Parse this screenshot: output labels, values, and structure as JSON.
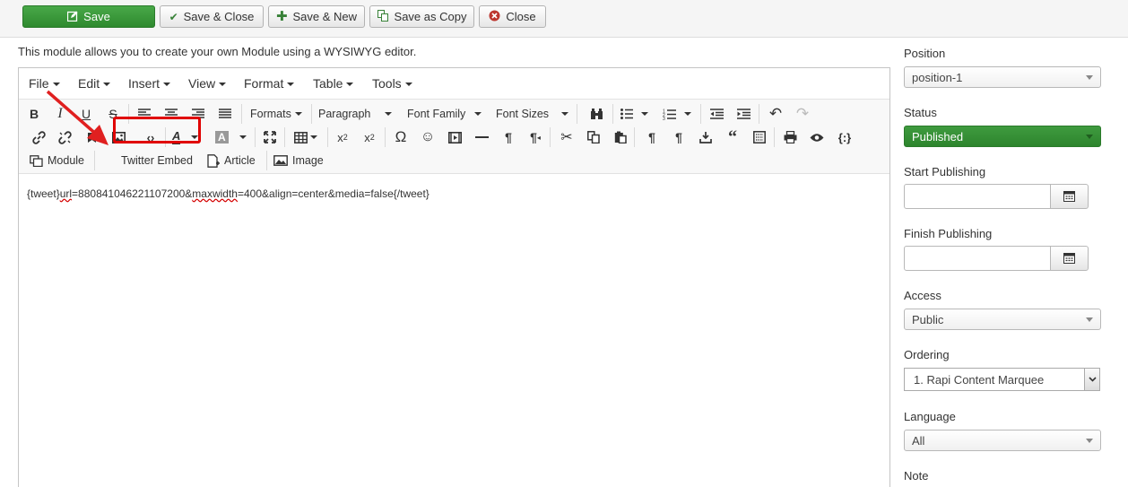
{
  "toolbar": {
    "save": "Save",
    "save_close": "Save & Close",
    "save_new": "Save & New",
    "save_copy": "Save as Copy",
    "close": "Close"
  },
  "description": "This module allows you to create your own Module using a WYSIWYG editor.",
  "editor": {
    "menus": [
      "File",
      "Edit",
      "Insert",
      "View",
      "Format",
      "Table",
      "Tools"
    ],
    "dropdowns": {
      "formats": "Formats",
      "paragraph": "Paragraph",
      "font_family": "Font Family",
      "font_sizes": "Font Sizes"
    },
    "buttons": {
      "module": "Module",
      "twitter_embed": "Twitter Embed",
      "article": "Article",
      "image": "Image"
    },
    "content_parts": {
      "open": "{tweet}",
      "url_word": "url",
      "mid": "=880841046221107200&",
      "maxwidth_word": "maxwidth",
      "rest": "=400&align=center&media=false{/tweet}"
    }
  },
  "sidebar": {
    "position_label": "Position",
    "position_value": "position-1",
    "status_label": "Status",
    "status_value": "Published",
    "start_label": "Start Publishing",
    "finish_label": "Finish Publishing",
    "access_label": "Access",
    "access_value": "Public",
    "ordering_label": "Ordering",
    "ordering_value": "1. Rapi Content Marquee",
    "language_label": "Language",
    "language_value": "All",
    "note_label": "Note"
  },
  "colors": {
    "save_green": "#3b973b",
    "highlight_red": "#e00000",
    "status_green": "#359035"
  }
}
